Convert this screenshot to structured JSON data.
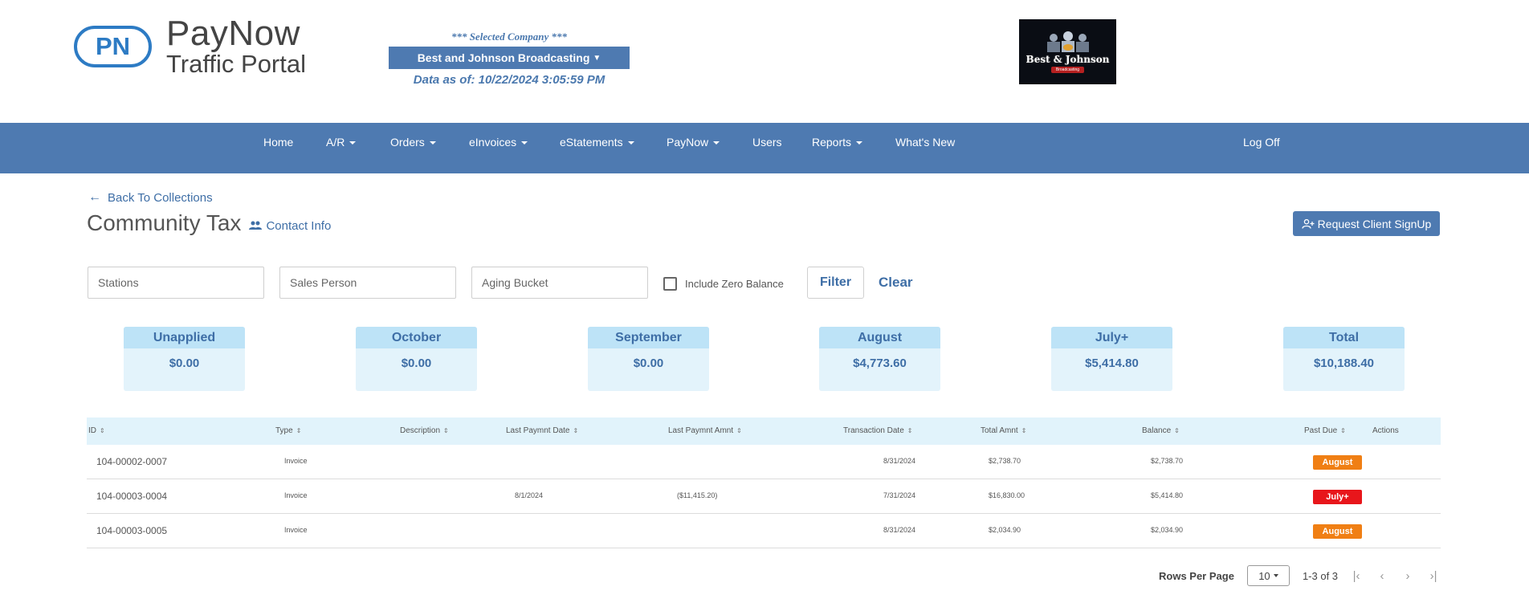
{
  "brand": {
    "badge": "PN",
    "line1": "PayNow",
    "line2": "Traffic Portal"
  },
  "company": {
    "selected_label": "*** Selected Company ***",
    "name": "Best and Johnson Broadcasting",
    "data_as_of": "Data as of: 10/22/2024 3:05:59 PM",
    "logo_text": "Best & Johnson",
    "logo_tag": "Broadcasting"
  },
  "nav": {
    "home": "Home",
    "ar": "A/R",
    "orders": "Orders",
    "einvoices": "eInvoices",
    "estatements": "eStatements",
    "paynow": "PayNow",
    "users": "Users",
    "reports": "Reports",
    "whats_new": "What's New",
    "log_off": "Log Off"
  },
  "page": {
    "back_label": "Back To Collections",
    "title": "Community Tax",
    "contact_info": "Contact Info",
    "request_signup": "Request Client SignUp"
  },
  "filters": {
    "stations_placeholder": "Stations",
    "sales_person_placeholder": "Sales Person",
    "aging_bucket_placeholder": "Aging Bucket",
    "include_zero_balance": "Include Zero Balance",
    "include_zero_balance_checked": false,
    "filter_label": "Filter",
    "clear_label": "Clear"
  },
  "summary": [
    {
      "label": "Unapplied",
      "value": "$0.00"
    },
    {
      "label": "October",
      "value": "$0.00"
    },
    {
      "label": "September",
      "value": "$0.00"
    },
    {
      "label": "August",
      "value": "$4,773.60"
    },
    {
      "label": "July+",
      "value": "$5,414.80"
    },
    {
      "label": "Total",
      "value": "$10,188.40"
    }
  ],
  "table": {
    "headers": {
      "id": "ID",
      "type": "Type",
      "description": "Description",
      "last_pay_date": "Last Paymnt Date",
      "last_pay_amt": "Last Paymnt Amnt",
      "trans_date": "Transaction Date",
      "total_amt": "Total Amnt",
      "balance": "Balance",
      "past_due": "Past Due",
      "actions": "Actions"
    },
    "rows": [
      {
        "id": "104-00002-0007",
        "type": "Invoice",
        "description": "",
        "last_pay_date": "",
        "last_pay_amt": "",
        "trans_date": "8/31/2024",
        "total_amt": "$2,738.70",
        "balance": "$2,738.70",
        "past_due": "August",
        "past_due_color": "#f07f14"
      },
      {
        "id": "104-00003-0004",
        "type": "Invoice",
        "description": "",
        "last_pay_date": "8/1/2024",
        "last_pay_amt": "($11,415.20)",
        "trans_date": "7/31/2024",
        "total_amt": "$16,830.00",
        "balance": "$5,414.80",
        "past_due": "July+",
        "past_due_color": "#e8161b"
      },
      {
        "id": "104-00003-0005",
        "type": "Invoice",
        "description": "",
        "last_pay_date": "",
        "last_pay_amt": "",
        "trans_date": "8/31/2024",
        "total_amt": "$2,034.90",
        "balance": "$2,034.90",
        "past_due": "August",
        "past_due_color": "#f07f14"
      }
    ]
  },
  "pagination": {
    "rows_per_page_label": "Rows Per Page",
    "rows_per_page": "10",
    "range": "1-3 of 3"
  },
  "colors": {
    "primary": "#4e7ab1",
    "link": "#3e6ea6",
    "card_bg": "#e3f3fb",
    "card_header": "#bde3f7",
    "badge_august": "#f07f14",
    "badge_july": "#e8161b"
  }
}
